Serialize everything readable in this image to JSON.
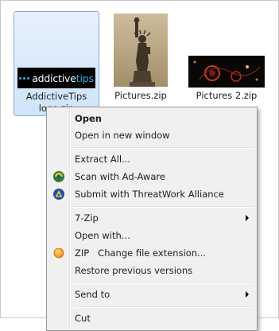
{
  "files": [
    {
      "name_line1": "AddictiveTips",
      "name_line2": "logo.zip",
      "logo_word1": "addictive",
      "logo_word2": "tips",
      "thumbnail_icon": "addictivetips-logo"
    },
    {
      "name": "Pictures.zip",
      "thumbnail_icon": "statue-of-liberty-photo"
    },
    {
      "name": "Pictures 2.zip",
      "thumbnail_icon": "dark-abstract-photo"
    }
  ],
  "menu": {
    "open": "Open",
    "open_new_window": "Open in new window",
    "extract_all": "Extract All...",
    "scan_adaware": "Scan with Ad-Aware",
    "threatwork": "Submit with ThreatWork Alliance",
    "seven_zip": "7-Zip",
    "open_with": "Open with...",
    "change_ext": "ZIP   Change file extension...",
    "restore": "Restore previous versions",
    "send_to": "Send to",
    "cut": "Cut"
  },
  "icons": {
    "adaware": "adaware-icon",
    "threatwork": "threatwork-icon",
    "change_ext": "orange-circle-icon",
    "submenu": "chevron-right-icon"
  }
}
